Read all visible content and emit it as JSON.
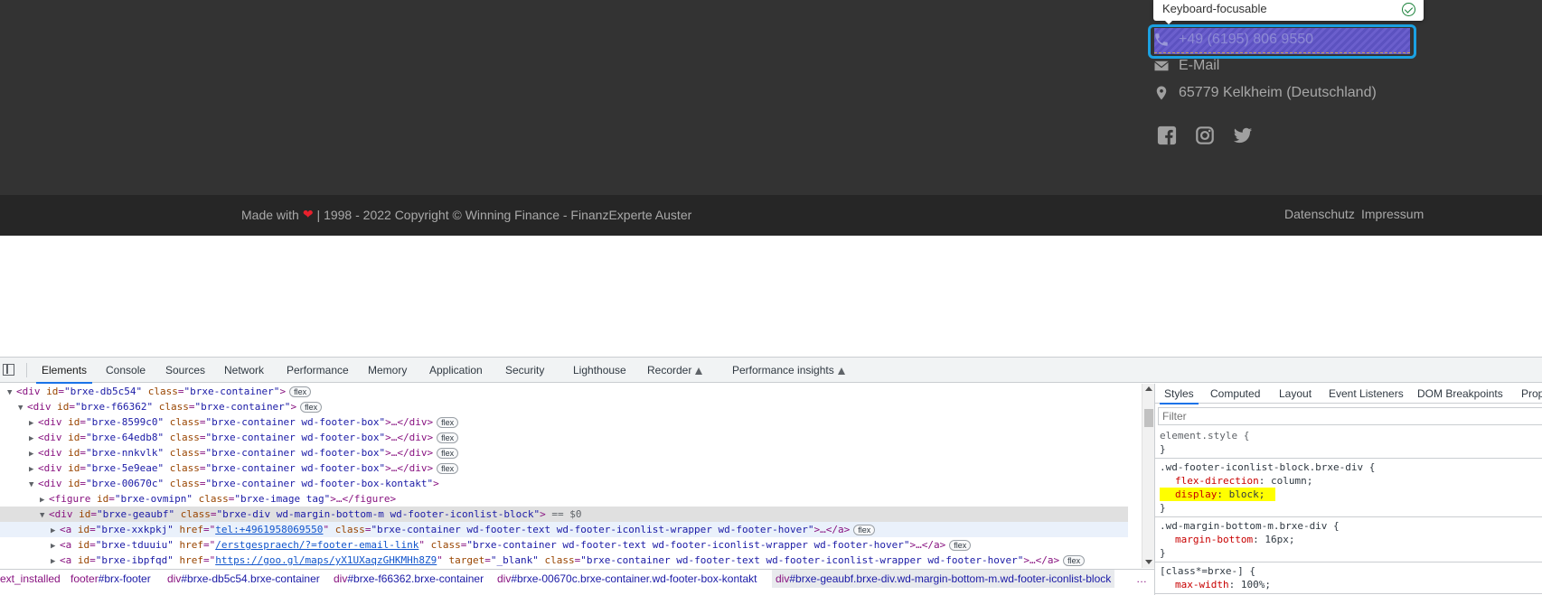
{
  "website": {
    "tooltip": {
      "text": "Keyboard-focusable"
    },
    "contact": {
      "phone": "+49 (6195) 806 9550",
      "email": "E-Mail",
      "location": "65779 Kelkheim (Deutschland)"
    },
    "socials": [
      "facebook-icon",
      "instagram-icon",
      "twitter-icon"
    ],
    "footer": {
      "made_with": "Made with",
      "copyright": "| 1998 - 2022 Copyright © Winning Finance - FinanzExperte Auster",
      "links": [
        "Datenschutz",
        "Impressum"
      ]
    },
    "colors": {
      "footer_bg": "#333333",
      "bottom_bg": "#262626",
      "highlight": "#1ba1e2",
      "heart": "#e8202c"
    }
  },
  "devtools": {
    "tabs": [
      "Elements",
      "Console",
      "Sources",
      "Network",
      "Performance",
      "Memory",
      "Application",
      "Security",
      "Lighthouse",
      "Recorder",
      "Performance insights"
    ],
    "active_tab": "Elements",
    "dom": {
      "r0": {
        "tag": "<div",
        "a1n": "id",
        "a1v": "\"brxe-db5c54\"",
        "a2n": "class",
        "a2v": "\"brxe-container\"",
        "end": ">",
        "badge": "flex"
      },
      "r1": {
        "tag": "<div",
        "a1n": "id",
        "a1v": "\"brxe-f66362\"",
        "a2n": "class",
        "a2v": "\"brxe-container\"",
        "end": ">",
        "badge": "flex"
      },
      "r2": {
        "tag": "<div",
        "a1n": "id",
        "a1v": "\"brxe-8599c0\"",
        "a2n": "class",
        "a2v": "\"brxe-container wd-footer-box\"",
        "end": ">…</div>",
        "badge": "flex"
      },
      "r3": {
        "tag": "<div",
        "a1n": "id",
        "a1v": "\"brxe-64edb8\"",
        "a2n": "class",
        "a2v": "\"brxe-container wd-footer-box\"",
        "end": ">…</div>",
        "badge": "flex"
      },
      "r4": {
        "tag": "<div",
        "a1n": "id",
        "a1v": "\"brxe-nnkvlk\"",
        "a2n": "class",
        "a2v": "\"brxe-container wd-footer-box\"",
        "end": ">…</div>",
        "badge": "flex"
      },
      "r5": {
        "tag": "<div",
        "a1n": "id",
        "a1v": "\"brxe-5e9eae\"",
        "a2n": "class",
        "a2v": "\"brxe-container wd-footer-box\"",
        "end": ">…</div>",
        "badge": "flex"
      },
      "r6": {
        "tag": "<div",
        "a1n": "id",
        "a1v": "\"brxe-00670c\"",
        "a2n": "class",
        "a2v": "\"brxe-container wd-footer-box-kontakt\"",
        "end": ">"
      },
      "r7": {
        "tag": "<figure",
        "a1n": "id",
        "a1v": "\"brxe-ovmipn\"",
        "a2n": "class",
        "a2v": "\"brxe-image tag\"",
        "end": ">…</figure>"
      },
      "r8": {
        "tag": "<div",
        "a1n": "id",
        "a1v": "\"brxe-geaubf\"",
        "a2n": "class",
        "a2v": "\"brxe-div wd-margin-bottom-m wd-footer-iconlist-block\"",
        "end": ">",
        "eq": "== $0"
      },
      "r9": {
        "tag": "<a",
        "a1n": "id",
        "a1v": "\"brxe-xxkpkj\"",
        "an_href": "href",
        "href": "tel:+4961958069550",
        "a2n": "class",
        "a2v": "\"brxe-container wd-footer-text wd-footer-iconlist-wrapper wd-footer-hover\"",
        "end": ">…</a>",
        "badge": "flex"
      },
      "r10": {
        "tag": "<a",
        "a1n": "id",
        "a1v": "\"brxe-tduuiu\"",
        "an_href": "href",
        "href": "/erstgespraech/?=footer-email-link",
        "a2n": "class",
        "a2v": "\"brxe-container wd-footer-text wd-footer-iconlist-wrapper wd-footer-hover\"",
        "end": ">…</a>",
        "badge": "flex"
      },
      "r11": {
        "tag": "<a",
        "a1n": "id",
        "a1v": "\"brxe-ibpfqd\"",
        "an_href": "href",
        "href": "https://goo.gl/maps/yX1UXaqzGHKMHh8Z9",
        "a3n": "target",
        "a3v": "\"_blank\"",
        "a2n": "class",
        "a2v": "\"brxe-container wd-footer-text wd-footer-iconlist-wrapper wd-footer-hover\"",
        "end": ">…</a>",
        "badge": "flex"
      }
    },
    "breadcrumbs": {
      "c0": {
        "t": "ext_installed",
        "c": ""
      },
      "c1": {
        "t": "footer",
        "c": "#brx-footer"
      },
      "c2": {
        "t": "div",
        "c": "#brxe-db5c54.brxe-container"
      },
      "c3": {
        "t": "div",
        "c": "#brxe-f66362.brxe-container"
      },
      "c4": {
        "t": "div",
        "c": "#brxe-00670c.brxe-container.wd-footer-box-kontakt"
      },
      "c5": {
        "t": "div",
        "c": "#brxe-geaubf.brxe-div.wd-margin-bottom-m.wd-footer-iconlist-block"
      },
      "more": "…"
    },
    "styles": {
      "tabs": [
        "Styles",
        "Computed",
        "Layout",
        "Event Listeners",
        "DOM Breakpoints",
        "Prop"
      ],
      "filter_placeholder": "Filter",
      "rules": {
        "s0": "element.style {",
        "s1": ".wd-footer-iconlist-block.brxe-div {",
        "p1a_n": "flex-direction",
        "p1a_v": "column;",
        "p1b_n": "display",
        "p1b_v": "block;",
        "s2": ".wd-margin-bottom-m.brxe-div {",
        "p2_n": "margin-bottom",
        "p2_v": "16px;",
        "s3": "[class*=brxe-] {",
        "p3_n": "max-width",
        "p3_v": "100%;",
        "close": "}"
      }
    }
  }
}
